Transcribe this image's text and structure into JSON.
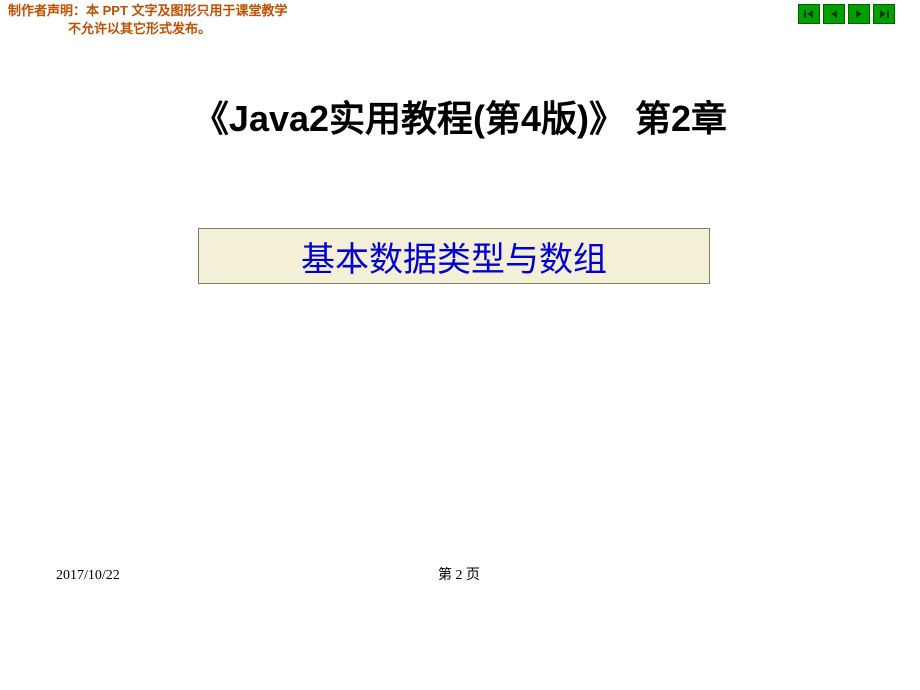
{
  "disclaimer": {
    "line1": "制作者声明：本 PPT 文字及图形只用于课堂教学",
    "line2": "不允许以其它形式发布。"
  },
  "nav": {
    "first": "first-page-icon",
    "prev": "prev-page-icon",
    "next": "next-page-icon",
    "last": "last-page-icon"
  },
  "title": "《Java2实用教程(第4版)》 第2章",
  "subtitle": "基本数据类型与数组",
  "footer": {
    "date": "2017/10/22",
    "page": "第 2 页"
  }
}
